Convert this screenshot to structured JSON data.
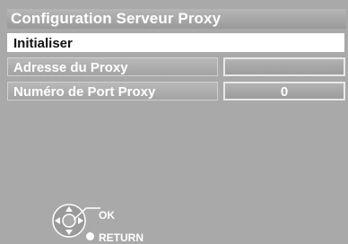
{
  "screen": {
    "title": "Configuration Serveur Proxy"
  },
  "menu": {
    "items": [
      {
        "label": "Initialiser",
        "selected": true,
        "value": null
      },
      {
        "label": "Adresse du Proxy",
        "selected": false,
        "value": ""
      },
      {
        "label": "Numéro de Port Proxy",
        "selected": false,
        "value": "0"
      }
    ]
  },
  "legend": {
    "ok_label": "OK",
    "return_label": "RETURN"
  },
  "colors": {
    "background": "#a9a9a9",
    "selected_row": "#ffffff",
    "text": "#ffffff"
  }
}
